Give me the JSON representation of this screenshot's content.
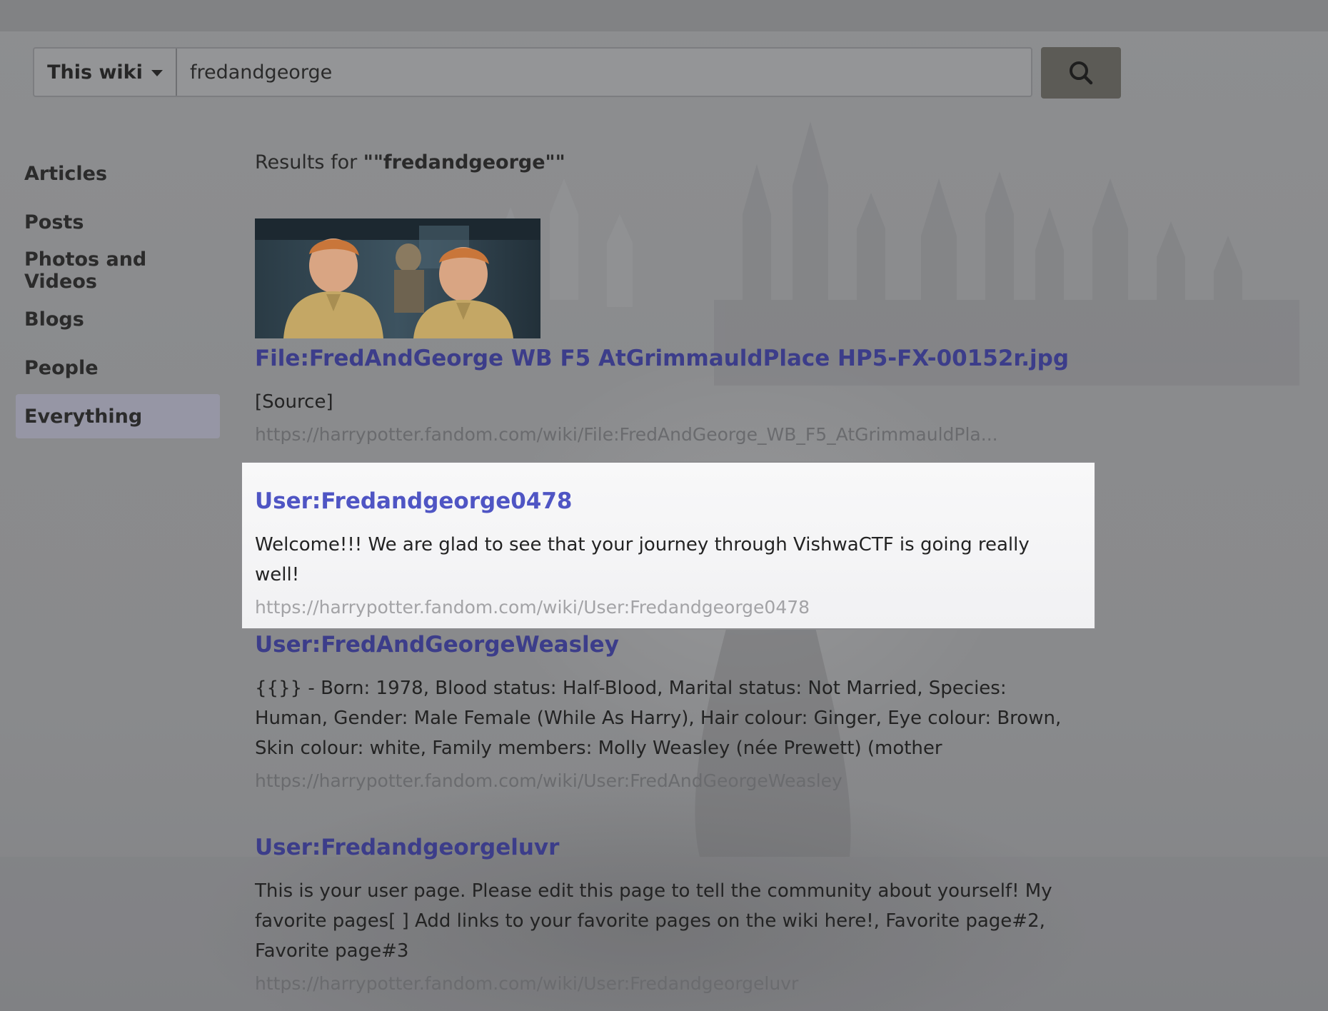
{
  "search": {
    "scope_label": "This wiki",
    "query": "fredandgeorge"
  },
  "nav": {
    "items": [
      {
        "label": "Articles"
      },
      {
        "label": "Posts"
      },
      {
        "label": "Photos and Videos"
      },
      {
        "label": "Blogs"
      },
      {
        "label": "People"
      },
      {
        "label": "Everything"
      }
    ],
    "active": "Everything"
  },
  "results_heading": {
    "prefix": "Results for ",
    "query": "\"\"fredandgeorge\"\""
  },
  "results": [
    {
      "title": "File:FredAndGeorge WB F5 AtGrimmauldPlace HP5-FX-00152r.jpg",
      "snippet": "[Source]",
      "url": "https://harrypotter.fandom.com/wiki/File:FredAndGeorge_WB_F5_AtGrimmauldPla...",
      "has_thumbnail": true
    },
    {
      "title": "User:Fredandgeorge0478",
      "snippet": "Welcome!!! We are glad to see that your journey through VishwaCTF is going really well!",
      "url": "https://harrypotter.fandom.com/wiki/User:Fredandgeorge0478",
      "highlighted": true
    },
    {
      "title": "User:FredAndGeorgeWeasley",
      "snippet": "{{}} - Born: 1978, Blood status: Half-Blood, Marital status: Not Married, Species: Human, Gender: Male Female (While As Harry), Hair colour: Ginger, Eye colour: Brown, Skin colour: white, Family members: Molly Weasley (née Prewett) (mother",
      "url": "https://harrypotter.fandom.com/wiki/User:FredAndGeorgeWeasley"
    },
    {
      "title": "User:Fredandgeorgeluvr",
      "snippet": "This is your user page. Please edit this page to tell the community about yourself! My favorite pages[ ] Add links to your favorite pages on the wiki here!, Favorite page#2, Favorite page#3",
      "url": "https://harrypotter.fandom.com/wiki/User:Fredandgeorgeluvr"
    }
  ],
  "colors": {
    "link": "#3c3d8a",
    "link_highlighted": "#4f55c4",
    "url": "#6a6b6e",
    "active_nav": "#a0a0b9"
  },
  "icons": {
    "search_button": "search-icon",
    "scope_caret": "caret-down-icon"
  }
}
